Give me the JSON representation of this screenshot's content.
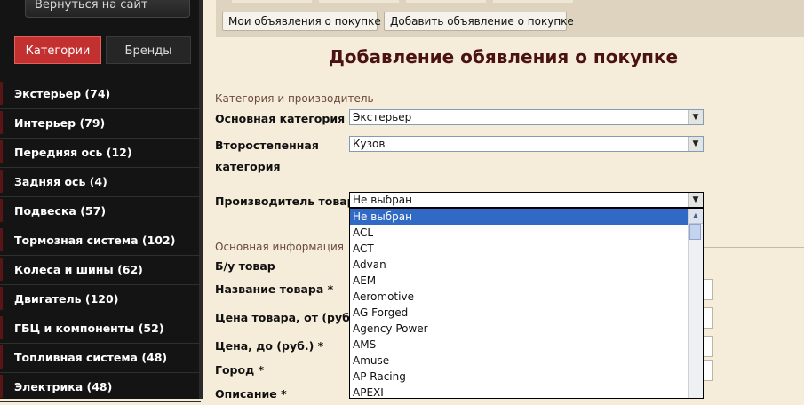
{
  "sidebar": {
    "back_label": "Вернуться на сайт",
    "tabs": [
      {
        "label": "Категории"
      },
      {
        "label": "Бренды"
      }
    ],
    "categories": [
      {
        "label": "Экстерьер (74)"
      },
      {
        "label": "Интерьер (79)"
      },
      {
        "label": "Передняя ось (12)"
      },
      {
        "label": "Задняя ось (4)"
      },
      {
        "label": "Подвеска (57)"
      },
      {
        "label": "Тормозная система (102)"
      },
      {
        "label": "Колеса и шины (62)"
      },
      {
        "label": "Двигатель (120)"
      },
      {
        "label": "ГБЦ и компоненты (52)"
      },
      {
        "label": "Топливная система (48)"
      },
      {
        "label": "Электрика (48)"
      }
    ]
  },
  "toolbar": {
    "my_ads_label": "Мои объявления о покупке",
    "add_ad_label": "Добавить объявление о покупке"
  },
  "page": {
    "title": "Добавление обявления о покупке"
  },
  "form": {
    "section_category": "Категория и производитель",
    "main_category_label": "Основная категория",
    "main_category_value": "Экстерьер",
    "secondary_category_label_1": "Второстепенная",
    "secondary_category_label_2": "категория",
    "secondary_category_value": "Кузов",
    "manufacturer_label": "Производитель товара",
    "manufacturer_value": "Не выбран",
    "section_main_info": "Основная информация",
    "used_label": "Б/у товар",
    "name_label": "Название товара *",
    "price_from_label": "Цена товара, от (руб.)",
    "price_to_label": "Цена, до (руб.) *",
    "city_label": "Город *",
    "description_label": "Описание *"
  },
  "manufacturer_options": [
    {
      "label": "Не выбран",
      "selected": true
    },
    {
      "label": "ACL"
    },
    {
      "label": "ACT"
    },
    {
      "label": "Advan"
    },
    {
      "label": "AEM"
    },
    {
      "label": "Aeromotive"
    },
    {
      "label": "AG Forged"
    },
    {
      "label": "Agency Power"
    },
    {
      "label": "AMS"
    },
    {
      "label": "Amuse"
    },
    {
      "label": "AP Racing"
    },
    {
      "label": "APEXI"
    }
  ],
  "colors": {
    "accent_red": "#c2302f",
    "sidebar_bg": "#141414",
    "title_color": "#4a1212",
    "selected_option": "#316ac5"
  }
}
